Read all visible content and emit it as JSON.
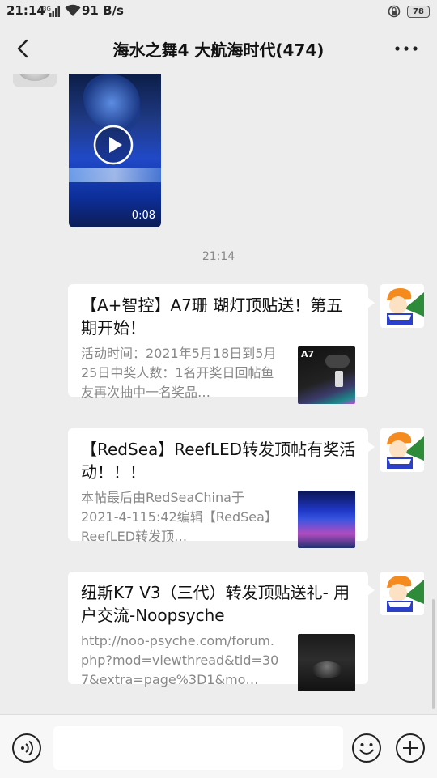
{
  "status_bar": {
    "time": "21:14",
    "network_type": "3G",
    "speed": "91 B/s",
    "battery": "78"
  },
  "header": {
    "title": "海水之舞4 大航海时代(474)",
    "back_icon": "back-arrow-icon",
    "more_icon": "more-icon"
  },
  "video_message": {
    "duration": "0:08"
  },
  "timestamp": "21:14",
  "messages": [
    {
      "title": "【A+智控】A7珊 瑚灯顶贴送！第五期开始！",
      "description": "活动时间：2021年5月18日到5月25日中奖人数：1名开奖日回帖鱼友再次抽中一名奖品…",
      "thumb_label": "A7"
    },
    {
      "title": "【RedSea】ReefLED转发顶帖有奖活动！！！",
      "description": "本帖最后由RedSeaChina于2021-4-115:42编辑【RedSea】ReefLED转发顶…"
    },
    {
      "title": "纽斯K7 V3（三代）转发顶贴送礼- 用户交流-Noopsyche",
      "description": "http://noo-psyche.com/forum.php?mod=viewthread&tid=307&extra=page%3D1&mo…"
    }
  ],
  "input_bar": {
    "text_value": "",
    "voice_icon": "voice-icon",
    "emoji_icon": "emoji-icon",
    "plus_icon": "plus-icon"
  },
  "colors": {
    "background": "#ededed",
    "card": "#ffffff",
    "secondary_text": "#888888"
  }
}
